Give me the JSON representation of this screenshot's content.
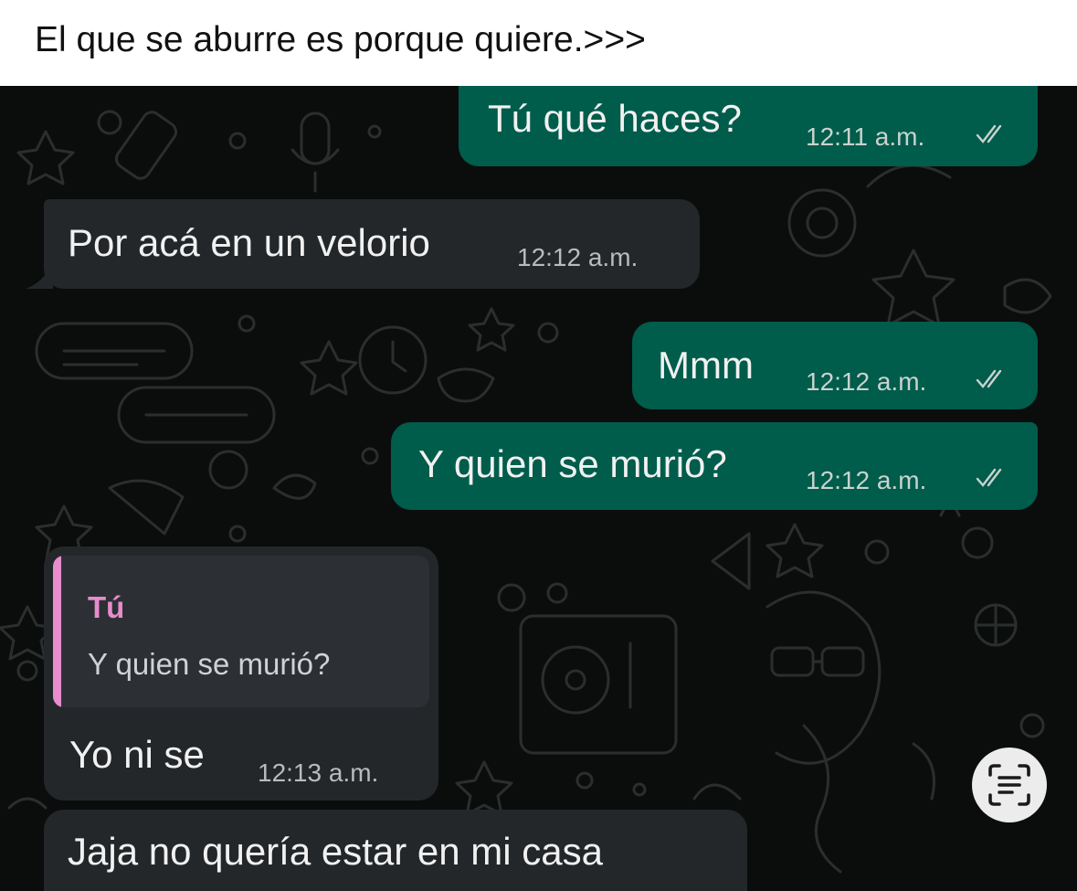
{
  "caption": {
    "text": "El que se aburre es porque quiere.>>>"
  },
  "colors": {
    "outgoing_bubble": "#005c4b",
    "incoming_bubble": "#23272a",
    "chat_background": "#0b0d0c",
    "quote_accent": "#e78ccd"
  },
  "messages": [
    {
      "direction": "outgoing",
      "text": "Tú qué haces?",
      "time": "12:11 a.m.",
      "status": "read"
    },
    {
      "direction": "incoming",
      "text": "Por acá en un velorio",
      "time": "12:12 a.m."
    },
    {
      "direction": "outgoing",
      "text": "Mmm",
      "time": "12:12 a.m.",
      "status": "read"
    },
    {
      "direction": "outgoing",
      "text": "Y quien se murió?",
      "time": "12:12 a.m.",
      "status": "read"
    },
    {
      "direction": "incoming",
      "text": "Yo ni se",
      "time": "12:13 a.m.",
      "quote": {
        "author": "Tú",
        "text": "Y quien se murió?"
      }
    },
    {
      "direction": "incoming",
      "text": "Jaja no quería estar en mi casa"
    }
  ],
  "overlay": {
    "icon": "text-scan-icon"
  }
}
